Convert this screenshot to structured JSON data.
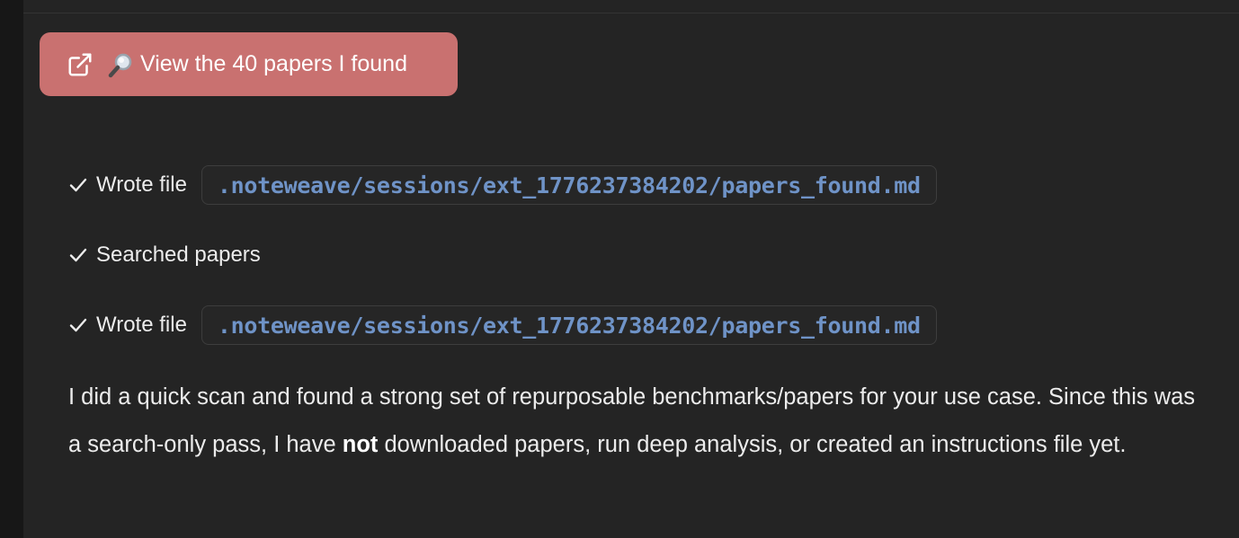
{
  "view_button": {
    "label": "View the 40 papers I found",
    "icon": "external-link-icon",
    "emoji_icon": "magnifier-icon"
  },
  "tool_calls": [
    {
      "label": "Wrote file",
      "path": ".noteweave/sessions/ext_1776237384202/papers_found.md",
      "status_icon": "check-icon"
    },
    {
      "label": "Searched papers",
      "status_icon": "check-icon"
    },
    {
      "label": "Wrote file",
      "path": ".noteweave/sessions/ext_1776237384202/papers_found.md",
      "status_icon": "check-icon"
    }
  ],
  "message": {
    "part1": "I did a quick scan and found a strong set of repurposable benchmarks/papers for your use case. Since this was a search-only pass, I have ",
    "emphasis": "not",
    "part2": " downloaded papers, run deep analysis, or created an instructions file yet."
  },
  "colors": {
    "background": "#242424",
    "button": "#c97170",
    "code_text": "#6f93c7",
    "text": "#ececec"
  }
}
